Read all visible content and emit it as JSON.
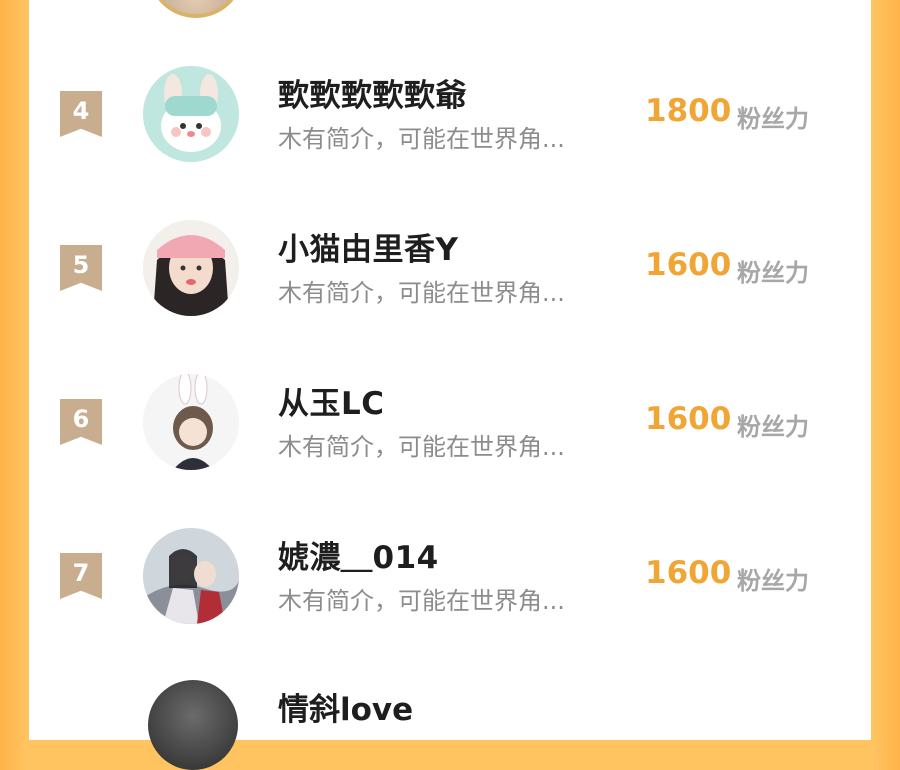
{
  "ranking": {
    "unit_label": "粉丝力",
    "rows": [
      {
        "rank": "4",
        "name": "歅歅歅歅歅爺",
        "bio": "木有简介，可能在世界角...",
        "score": "1800"
      },
      {
        "rank": "5",
        "name": "小猫由里香Y",
        "bio": "木有简介，可能在世界角...",
        "score": "1600"
      },
      {
        "rank": "6",
        "name": "从玉LC",
        "bio": "木有简介，可能在世界角...",
        "score": "1600"
      },
      {
        "rank": "7",
        "name": "婋濃＿014",
        "bio": "木有简介，可能在世界角...",
        "score": "1600"
      }
    ],
    "partial_next_name": "情斜love"
  },
  "colors": {
    "score": "#f0a534",
    "rank_badge": "#c8ad8e",
    "background": "#ffc460"
  }
}
